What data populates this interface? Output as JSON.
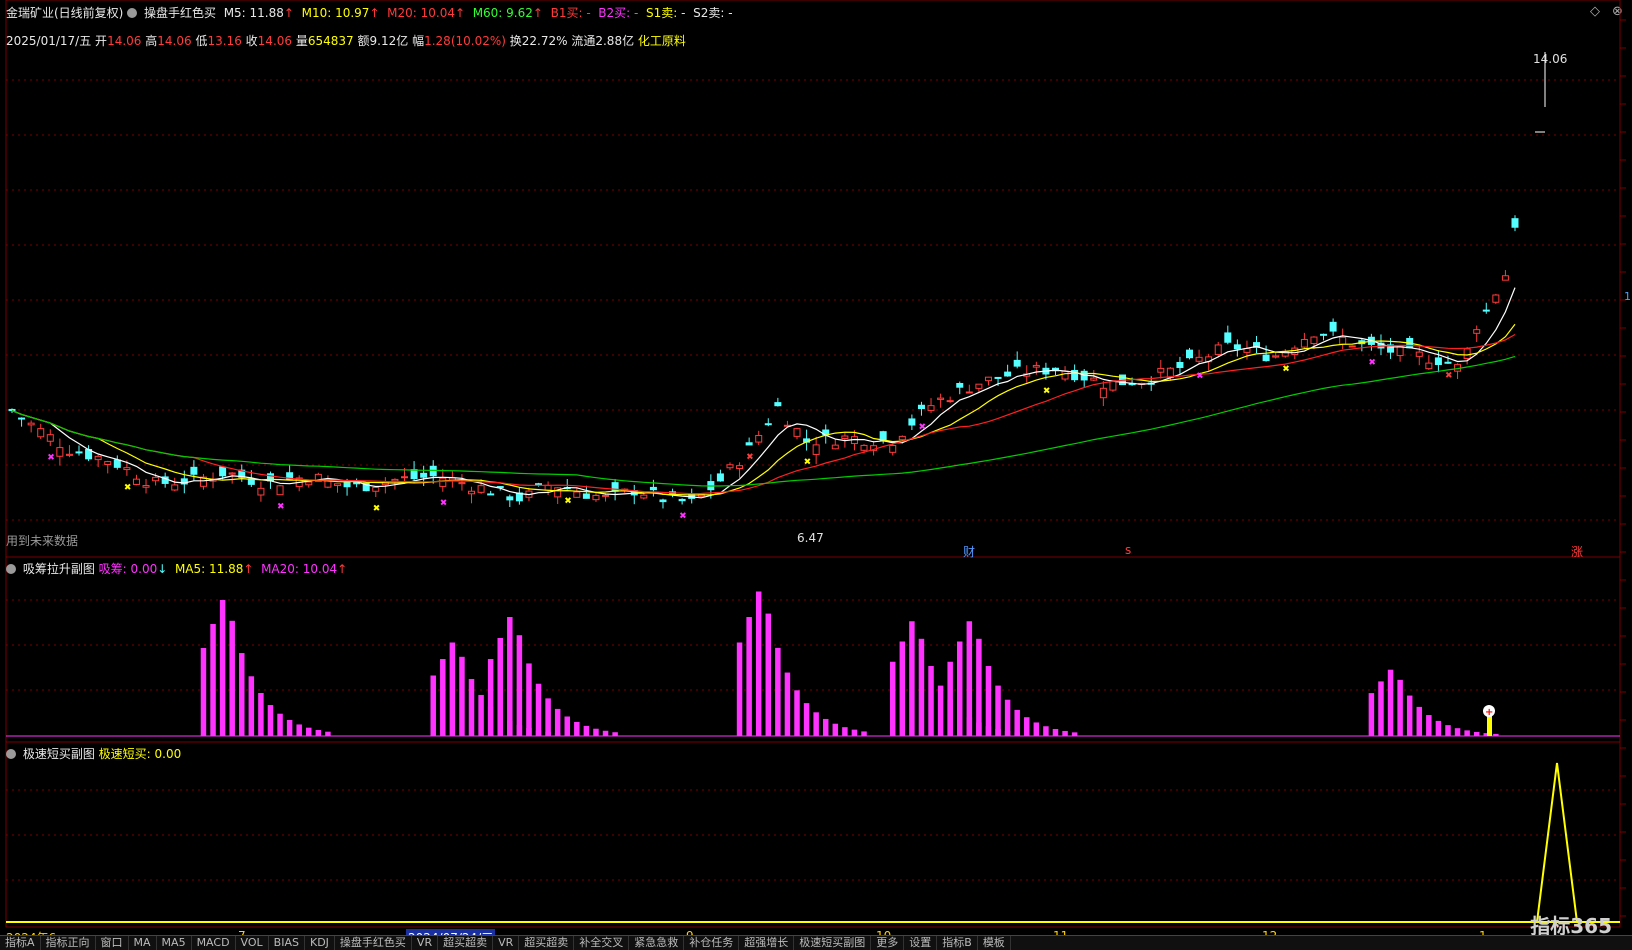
{
  "header": {
    "title": "金瑞矿业(日线前复权)",
    "indicator_name": "操盘手红色买",
    "m5": "M5: 11.88",
    "m10": "M10: 10.97",
    "m20": "M20: 10.04",
    "m60": "M60: 9.62",
    "b1": "B1买: -",
    "b2": "B2买: -",
    "s1": "S1卖: -",
    "s2": "S2卖: -"
  },
  "info": {
    "date": "2025/01/17/五",
    "open_lbl": "开",
    "open": "14.06",
    "high_lbl": "高",
    "high": "14.06",
    "low_lbl": "低",
    "low": "13.16",
    "close_lbl": "收",
    "close": "14.06",
    "vol_lbl": "量",
    "vol": "654837",
    "amt": "额9.12亿",
    "chg_lbl": "幅",
    "chg": "1.28(10.02%)",
    "turn": "换22.72%",
    "float": "流通2.88亿",
    "sector": "化工原料"
  },
  "main": {
    "top_price": "14.06",
    "low_price": "6.47",
    "note": "用到未来数据",
    "tag_cai": "财",
    "tag_s": "s",
    "tag_zhang": "涨",
    "right_label": "1"
  },
  "sub1": {
    "title": "吸筹拉升副图",
    "xichou": "吸筹: 0.00",
    "ma5": "MA5: 11.88",
    "ma20": "MA20: 10.04"
  },
  "sub2": {
    "title": "极速短买副图",
    "value": "极速短买: 0.00"
  },
  "dates": {
    "d1": "2024年6",
    "d2": "7",
    "d3": "2024/07/24/三",
    "d4": "9",
    "d5": "10",
    "d6": "11",
    "d7": "12",
    "d8": "1"
  },
  "logo": "指标365",
  "bottombar": [
    "指标A",
    "指标正向",
    "窗口",
    "MA",
    "MA5",
    "MACD",
    "VOL",
    "BIAS",
    "KDJ",
    "操盘手红色买",
    "VR",
    "超买超卖",
    "VR",
    "超买超卖",
    "补全交叉",
    "紧急急救",
    "补仓任务",
    "超强增长",
    "极速短买副图",
    "更多",
    "设置",
    "指标B",
    "模板"
  ],
  "colors": {
    "up": "#ff3b3b",
    "down": "#55ffff",
    "ma5": "#ffffff",
    "ma10": "#ffff00",
    "ma20": "#ff2020",
    "ma60": "#00cc00",
    "magenta": "#ff33ff",
    "yellow": "#ffff00",
    "grid": "#7a0000"
  }
}
